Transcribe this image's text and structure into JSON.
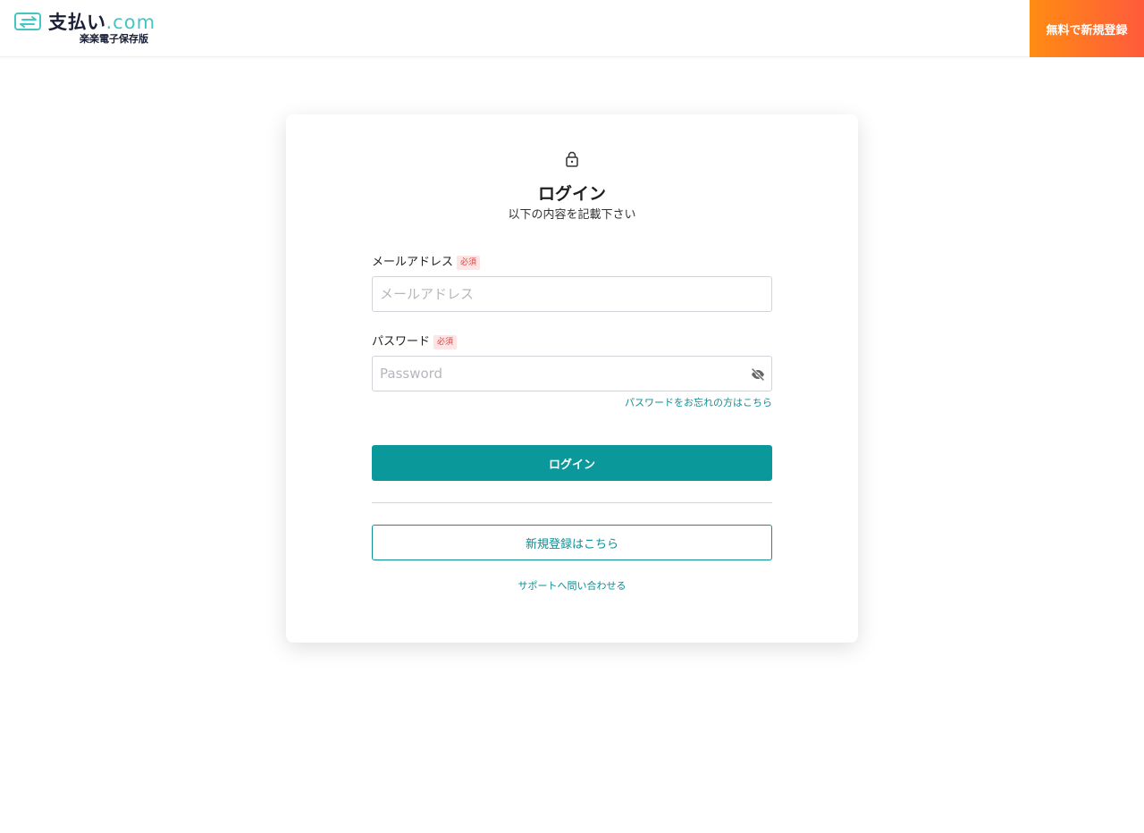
{
  "header": {
    "logo_main": "支払い",
    "logo_suffix": ".com",
    "logo_sub": "楽楽電子保存版",
    "signup_label": "無料で新規登録"
  },
  "login": {
    "title": "ログイン",
    "subtitle": "以下の内容を記載下さい",
    "email_label": "メールアドレス",
    "email_placeholder": "メールアドレス",
    "email_value": "",
    "password_label": "パスワード",
    "password_placeholder": "Password",
    "password_value": "",
    "required_badge": "必須",
    "forgot_link": "パスワードをお忘れの方はこちら",
    "login_button": "ログイン",
    "register_button": "新規登録はこちら",
    "support_link": "サポートへ問い合わせる"
  },
  "icons": {
    "logo": "transfer-arrows-icon",
    "lock": "lock-icon",
    "eye": "eye-slash-icon"
  },
  "colors": {
    "accent": "#0a989b",
    "link": "#0a8f95",
    "signup_gradient_start": "#ff8c12",
    "signup_gradient_end": "#ff5a3c",
    "required_bg": "#fde5e5",
    "required_text": "#d64545"
  }
}
